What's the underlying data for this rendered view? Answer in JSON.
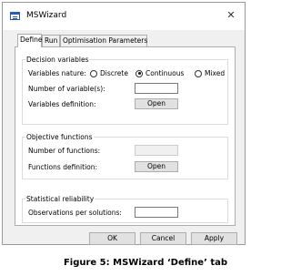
{
  "window": {
    "title": "MSWizard",
    "close": "✕"
  },
  "tabs": [
    {
      "label": "Define",
      "active": true
    },
    {
      "label": "Run",
      "active": false
    },
    {
      "label": "Optimisation Parameters",
      "active": false
    }
  ],
  "decision": {
    "title": "Decision variables",
    "nature_label": "Variables nature:",
    "options": [
      {
        "label": "Discrete",
        "checked": false
      },
      {
        "label": "Continuous",
        "checked": true
      },
      {
        "label": "Mixed",
        "checked": false
      }
    ],
    "num_label": "Number of variable(s):",
    "num_value": "",
    "def_label": "Variables definition:",
    "open_label": "Open"
  },
  "objective": {
    "title": "Objective functions",
    "num_label": "Number of functions:",
    "num_value": "",
    "def_label": "Functions definition:",
    "open_label": "Open"
  },
  "statistical": {
    "title": "Statistical reliability",
    "obs_label": "Observations per solutions:",
    "obs_value": ""
  },
  "footer": {
    "ok": "OK",
    "cancel": "Cancel",
    "apply": "Apply"
  },
  "caption": "Figure 5: MSWizard ‘Define’ tab"
}
